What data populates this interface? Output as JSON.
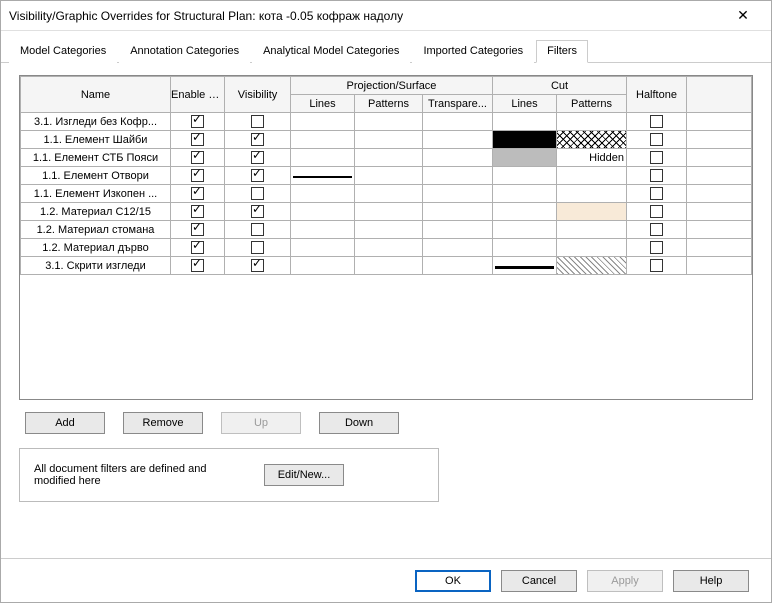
{
  "window": {
    "title": "Visibility/Graphic Overrides for Structural Plan: кота -0.05 кофраж надолу"
  },
  "tabs": {
    "items": [
      {
        "label": "Model Categories"
      },
      {
        "label": "Annotation Categories"
      },
      {
        "label": "Analytical Model Categories"
      },
      {
        "label": "Imported Categories"
      },
      {
        "label": "Filters"
      }
    ],
    "active_index": 4
  },
  "grid": {
    "headers": {
      "name": "Name",
      "enable": "Enable Filter",
      "visibility": "Visibility",
      "projection_group": "Projection/Surface",
      "cut_group": "Cut",
      "halftone": "Halftone",
      "lines": "Lines",
      "patterns": "Patterns",
      "transparency": "Transpare..."
    },
    "rows": [
      {
        "name": "3.1.  Изгледи без Кофр...",
        "enable": true,
        "visibility": false,
        "proj_lines": "",
        "proj_pat": "",
        "trans": "",
        "cut_lines": "",
        "cut_pat": "",
        "halftone": false
      },
      {
        "name": "1.1.  Елемент Шайби",
        "enable": true,
        "visibility": true,
        "proj_lines": "",
        "proj_pat": "",
        "trans": "",
        "cut_lines": "solid-black",
        "cut_pat": "crosshatch",
        "halftone": false
      },
      {
        "name": "1.1.  Елемент СТБ Пояси",
        "enable": true,
        "visibility": true,
        "proj_lines": "",
        "proj_pat": "",
        "trans": "",
        "cut_lines": "grey",
        "cut_pat": "hidden-lbl",
        "cut_pat_text": "Hidden",
        "halftone": false
      },
      {
        "name": "1.1.  Елемент Отвори",
        "enable": true,
        "visibility": true,
        "proj_lines": "line-thin",
        "proj_pat": "",
        "trans": "",
        "cut_lines": "",
        "cut_pat": "",
        "halftone": false
      },
      {
        "name": "1.1.  Елемент Изкопен ...",
        "enable": true,
        "visibility": false,
        "proj_lines": "",
        "proj_pat": "",
        "trans": "",
        "cut_lines": "",
        "cut_pat": "",
        "halftone": false
      },
      {
        "name": "1.2.  Материал C12/15",
        "enable": true,
        "visibility": true,
        "proj_lines": "",
        "proj_pat": "",
        "trans": "",
        "cut_lines": "",
        "cut_pat": "peach",
        "halftone": false
      },
      {
        "name": "1.2.  Материал стомана",
        "enable": true,
        "visibility": false,
        "proj_lines": "",
        "proj_pat": "",
        "trans": "",
        "cut_lines": "",
        "cut_pat": "",
        "halftone": false
      },
      {
        "name": "1.2.  Материал дърво",
        "enable": true,
        "visibility": false,
        "proj_lines": "",
        "proj_pat": "",
        "trans": "",
        "cut_lines": "",
        "cut_pat": "",
        "halftone": false
      },
      {
        "name": "3.1.  Скрити изгледи",
        "enable": true,
        "visibility": true,
        "proj_lines": "",
        "proj_pat": "",
        "trans": "",
        "cut_lines": "line-med",
        "cut_pat": "diag",
        "halftone": false
      }
    ]
  },
  "buttons": {
    "add": "Add",
    "remove": "Remove",
    "up": "Up",
    "down": "Down",
    "edit_new": "Edit/New..."
  },
  "info_text": "All document filters are defined and modified here",
  "footer": {
    "ok": "OK",
    "cancel": "Cancel",
    "apply": "Apply",
    "help": "Help"
  }
}
